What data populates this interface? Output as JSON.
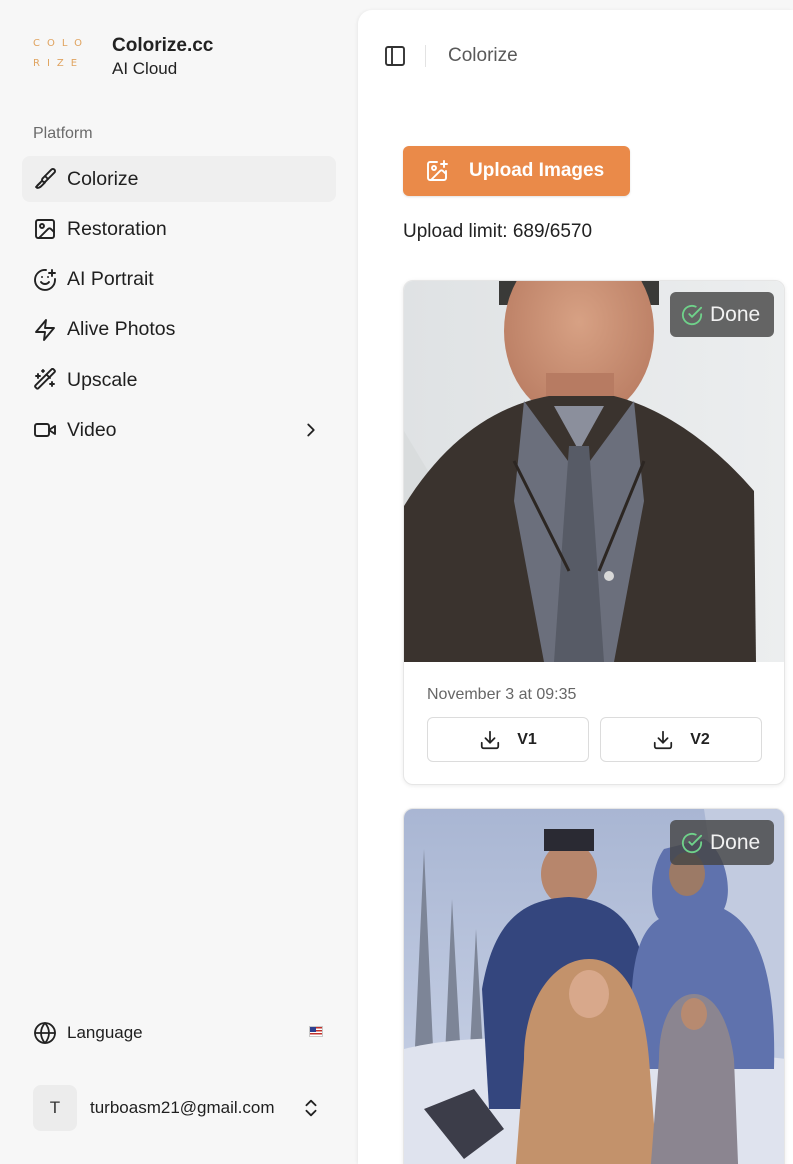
{
  "brand": {
    "logo_line1": "COLO",
    "logo_line2": "RIZE",
    "name": "Colorize.cc",
    "subtitle": "AI Cloud",
    "logo_color": "#e0a35f"
  },
  "sidebar": {
    "section_label": "Platform",
    "items": [
      {
        "label": "Colorize",
        "icon": "paintbrush-icon",
        "active": true
      },
      {
        "label": "Restoration",
        "icon": "image-icon"
      },
      {
        "label": "AI Portrait",
        "icon": "smile-plus-icon"
      },
      {
        "label": "Alive Photos",
        "icon": "zap-icon"
      },
      {
        "label": "Upscale",
        "icon": "magic-wand-icon"
      },
      {
        "label": "Video",
        "icon": "video-icon",
        "has_submenu": true
      }
    ],
    "language_label": "Language",
    "language_flag": "us-flag-icon",
    "user": {
      "initial": "T",
      "email": "turboasm21@gmail.com"
    }
  },
  "header": {
    "breadcrumb": "Colorize"
  },
  "main": {
    "upload_button": "Upload Images",
    "upload_limit": "Upload limit: 689/6570",
    "accent_color": "#ea8a49",
    "cards": [
      {
        "status": "Done",
        "date": "November 3 at 09:35",
        "download_v1": "V1",
        "download_v2": "V2"
      },
      {
        "status": "Done"
      }
    ]
  }
}
